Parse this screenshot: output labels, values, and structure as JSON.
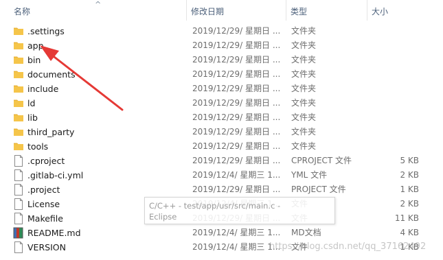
{
  "columns": {
    "name": "名称",
    "date": "修改日期",
    "type": "类型",
    "size": "大小"
  },
  "sort_indicator": "^",
  "files": [
    {
      "name": ".settings",
      "date": "2019/12/29/ 星期日 ...",
      "type": "文件夹",
      "size": "",
      "icon": "folder-icon"
    },
    {
      "name": "app",
      "date": "2019/12/29/ 星期日 ...",
      "type": "文件夹",
      "size": "",
      "icon": "folder-icon"
    },
    {
      "name": "bin",
      "date": "2019/12/29/ 星期日 ...",
      "type": "文件夹",
      "size": "",
      "icon": "folder-icon"
    },
    {
      "name": "documents",
      "date": "2019/12/29/ 星期日 ...",
      "type": "文件夹",
      "size": "",
      "icon": "folder-icon"
    },
    {
      "name": "include",
      "date": "2019/12/29/ 星期日 ...",
      "type": "文件夹",
      "size": "",
      "icon": "folder-icon"
    },
    {
      "name": "ld",
      "date": "2019/12/29/ 星期日 ...",
      "type": "文件夹",
      "size": "",
      "icon": "folder-icon"
    },
    {
      "name": "lib",
      "date": "2019/12/29/ 星期日 ...",
      "type": "文件夹",
      "size": "",
      "icon": "folder-icon"
    },
    {
      "name": "third_party",
      "date": "2019/12/29/ 星期日 ...",
      "type": "文件夹",
      "size": "",
      "icon": "folder-icon"
    },
    {
      "name": "tools",
      "date": "2019/12/29/ 星期日 ...",
      "type": "文件夹",
      "size": "",
      "icon": "folder-icon"
    },
    {
      "name": ".cproject",
      "date": "2019/12/29/ 星期日 ...",
      "type": "CPROJECT 文件",
      "size": "5 KB",
      "icon": "file-icon"
    },
    {
      "name": ".gitlab-ci.yml",
      "date": "2019/12/4/ 星期三 1...",
      "type": "YML 文件",
      "size": "2 KB",
      "icon": "file-icon"
    },
    {
      "name": ".project",
      "date": "2019/12/29/ 星期日 ...",
      "type": "PROJECT 文件",
      "size": "1 KB",
      "icon": "file-icon"
    },
    {
      "name": "License",
      "date": "2019/12/4/ 星期三 1...",
      "type": "文件",
      "size": "2 KB",
      "icon": "file-icon"
    },
    {
      "name": "Makefile",
      "date": "2019/12/29/ 星期日 ...",
      "type": "文件",
      "size": "11 KB",
      "icon": "file-icon"
    },
    {
      "name": "README.md",
      "date": "2019/12/4/ 星期三 1...",
      "type": "MD文档",
      "size": "4 KB",
      "icon": "markdown-file-icon"
    },
    {
      "name": "VERSION",
      "date": "2019/12/4/ 星期三 1...",
      "type": "文件",
      "size": "1 KB",
      "icon": "file-icon"
    }
  ],
  "tooltip": {
    "line1": "C/C++ - test/app/usr/src/main.c -",
    "line2": "Eclipse"
  },
  "watermark": "https://blog.csdn.net/qq_37162492",
  "colors": {
    "header_text": "#4c607a",
    "folder": "#f5c54a",
    "annotation_arrow": "#e53935"
  }
}
